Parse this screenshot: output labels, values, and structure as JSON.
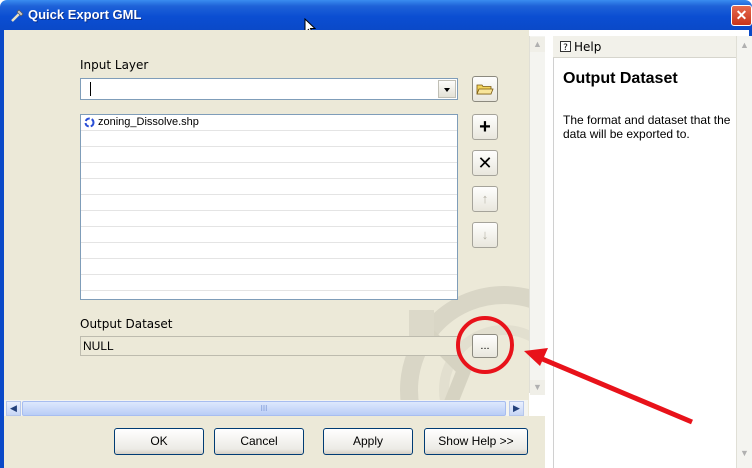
{
  "window": {
    "title": "Quick Export GML",
    "close_glyph": "✕",
    "title_icon": "tool-icon"
  },
  "form": {
    "input_layer_label": "Input Layer",
    "input_layer_value": "",
    "layers": [
      "zoning_Dissolve.shp"
    ],
    "output_dataset_label": "Output Dataset",
    "output_dataset_value": "NULL"
  },
  "side_buttons": {
    "add": "+",
    "remove": "✕",
    "up": "↑",
    "down": "↓",
    "browse": "..."
  },
  "buttons": {
    "ok": "OK",
    "cancel": "Cancel",
    "apply": "Apply",
    "show_help": "Show Help >>"
  },
  "help": {
    "tab_label": "Help",
    "title": "Output Dataset",
    "body": "The format and dataset that the data will be exported to."
  },
  "scroll": {
    "up": "▲",
    "down": "▼",
    "left": "◀",
    "right": "▶",
    "thumb_grip": "III"
  },
  "colors": {
    "titlebar": "#0b4ed2",
    "annotation": "#e8121a",
    "dialog_bg": "#ece9d8"
  }
}
